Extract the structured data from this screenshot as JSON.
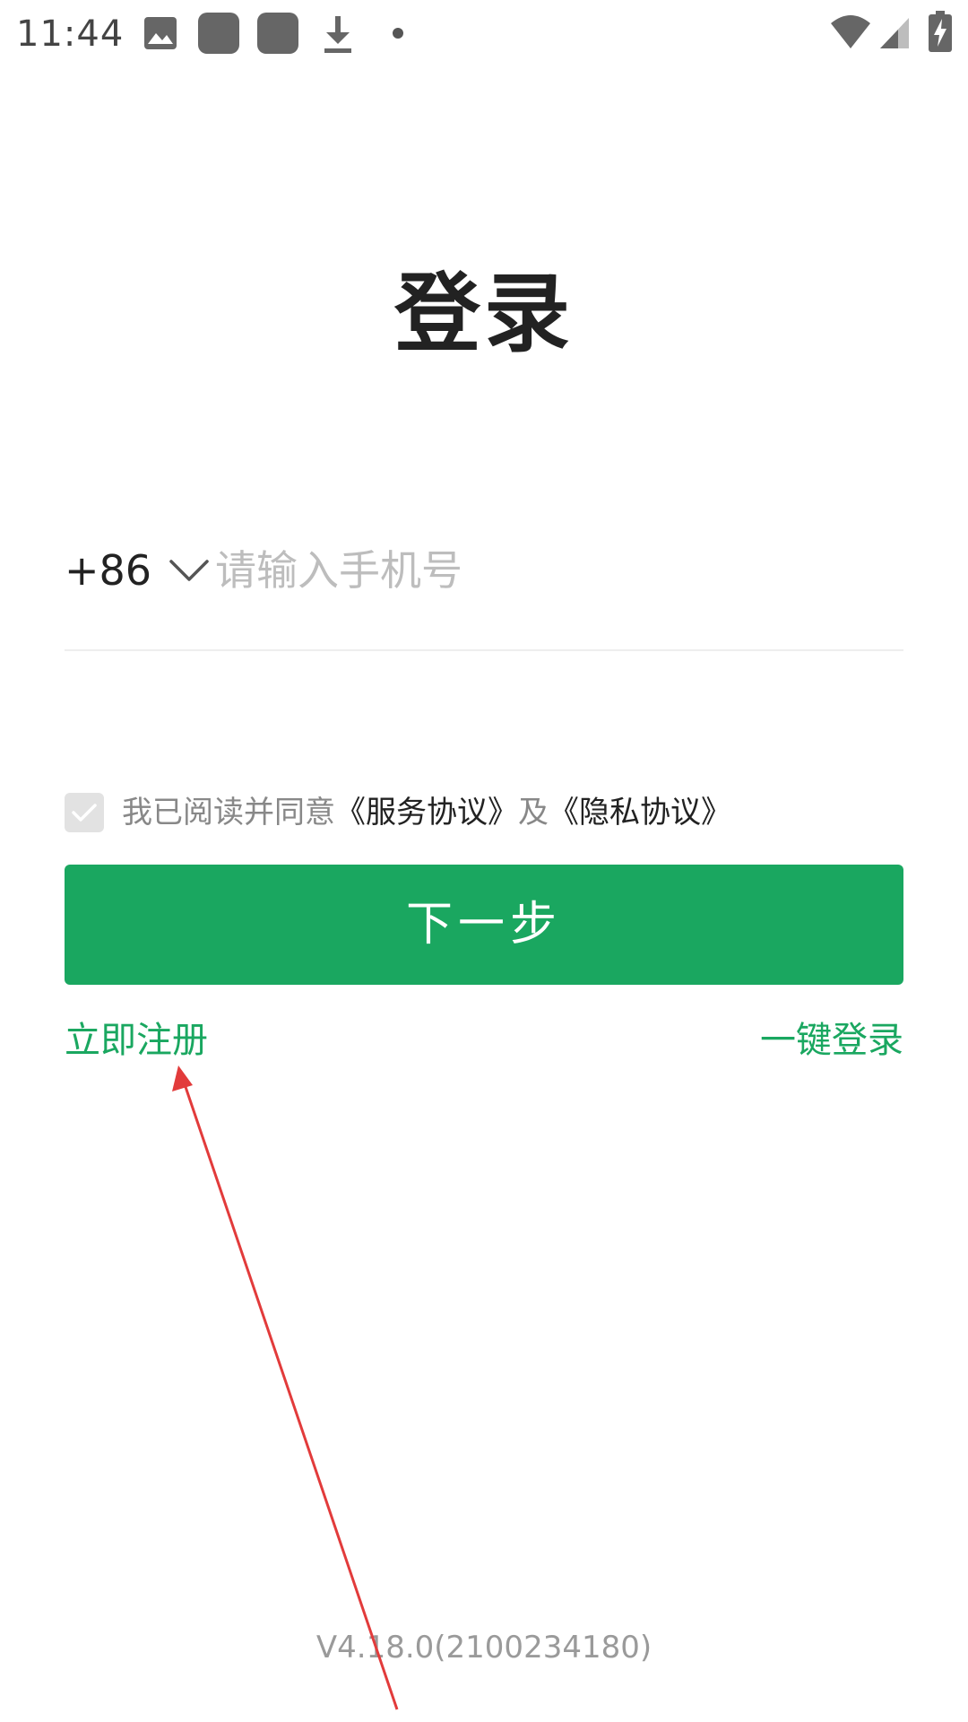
{
  "status_bar": {
    "time": "11:44",
    "icons": [
      "image-icon",
      "app-icon",
      "app-icon",
      "download-icon",
      "dot-icon",
      "wifi-icon",
      "signal-icon",
      "battery-charging-icon"
    ]
  },
  "title": "登录",
  "phone": {
    "country_code": "+86",
    "placeholder": "请输入手机号",
    "value": ""
  },
  "agreement": {
    "checked": true,
    "prefix": "我已阅读并同意",
    "service_link": "《服务协议》",
    "conjunction": "及",
    "privacy_link": "《隐私协议》"
  },
  "actions": {
    "next_label": "下一步",
    "register_label": "立即注册",
    "quick_login_label": "一键登录"
  },
  "footer": {
    "version": "V4.18.0(2100234180)"
  },
  "colors": {
    "accent": "#1aa760",
    "title": "#222222",
    "muted": "#888888",
    "placeholder": "#bdbdbd",
    "annotation_arrow": "#e23b3b"
  }
}
